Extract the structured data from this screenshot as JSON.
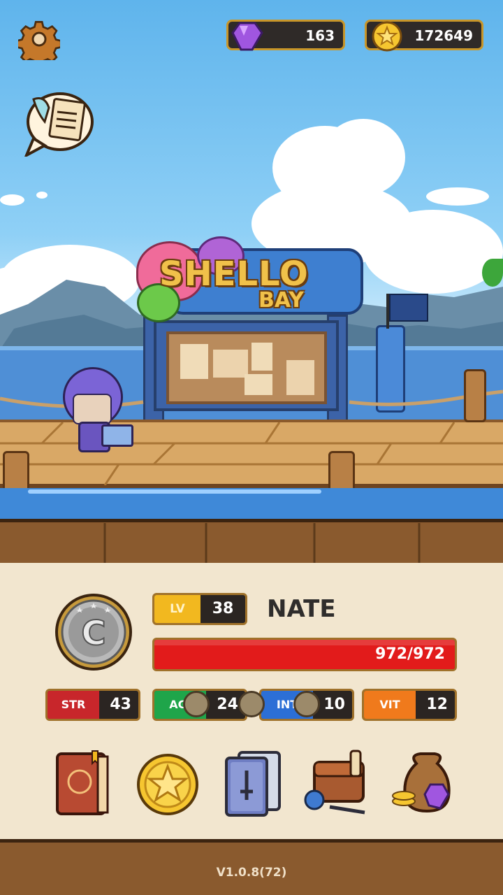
{
  "hud": {
    "gems": "163",
    "coins": "172649",
    "settings_icon": "gear-icon",
    "quest_icon": "quest-scroll-icon"
  },
  "scene": {
    "sign_line1": "SHELLO",
    "sign_line2": "BAY"
  },
  "character": {
    "level_label": "LV",
    "level": "38",
    "name": "NATE",
    "hp_text": "972/972",
    "hp_fraction": 1.0,
    "rank_icon": "silver-rank-medal-icon"
  },
  "stats": [
    {
      "label": "STR",
      "value": "43",
      "color": "#c8262b"
    },
    {
      "label": "AGI",
      "value": "24",
      "color": "#1fa54a"
    },
    {
      "label": "INT",
      "value": "10",
      "color": "#2c6fd6"
    },
    {
      "label": "VIT",
      "value": "12",
      "color": "#f07a1c"
    }
  ],
  "menu": [
    {
      "icon": "spellbook-icon"
    },
    {
      "icon": "gold-star-coin-icon"
    },
    {
      "icon": "skill-cards-icon"
    },
    {
      "icon": "inventory-bag-icon"
    },
    {
      "icon": "treasure-sack-icon"
    }
  ],
  "version": "V1.0.8(72)",
  "colors": {
    "hp_bar": "#e21b1b",
    "level_badge": "#f2b81f",
    "frame": "#c8962a"
  }
}
